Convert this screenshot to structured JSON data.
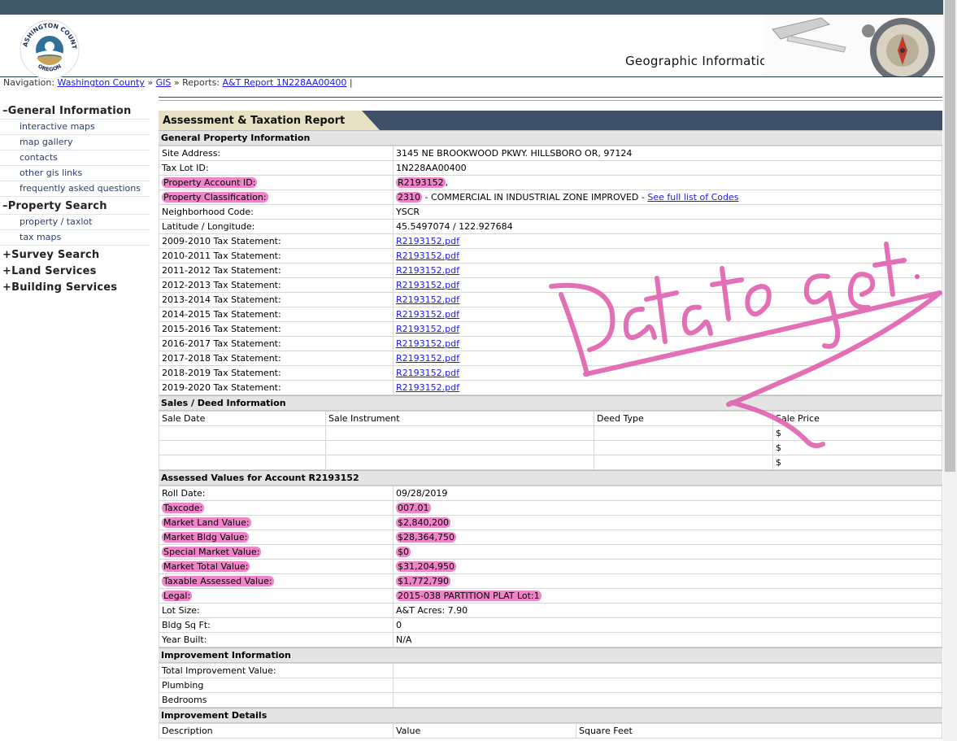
{
  "header": {
    "logo_top_text": "WASHINGTON COUNTY",
    "logo_bottom_text": "OREGON",
    "gis_title": "Geographic Information Systems"
  },
  "nav": {
    "prefix": "Navigation:",
    "crumbs": [
      "Washington County",
      "GIS"
    ],
    "reports_label": "Reports:",
    "report_link": "A&T Report 1N228AA00400",
    "sep": "»",
    "bar": "|"
  },
  "sidebar": {
    "general": {
      "title": "General Information",
      "marker": "–",
      "items": [
        "interactive maps",
        "map gallery",
        "contacts",
        "other gis links",
        "frequently asked questions"
      ]
    },
    "property": {
      "title": "Property Search",
      "marker": "–",
      "items": [
        "property / taxlot",
        "tax maps"
      ]
    },
    "collapsed": [
      {
        "marker": "+",
        "title": "Survey Search"
      },
      {
        "marker": "+",
        "title": "Land Services"
      },
      {
        "marker": "+",
        "title": "Building Services"
      }
    ]
  },
  "report": {
    "title": "Assessment & Taxation Report",
    "general_heading": "General Property Information",
    "general_rows": [
      {
        "label": "Site Address:",
        "value": "3145 NE BROOKWOOD PKWY. HILLSBORO OR, 97124"
      },
      {
        "label": "Tax Lot ID:",
        "value": "1N228AA00400"
      },
      {
        "label": "Property Account ID:",
        "value": "R2193152",
        "suffix": ","
      },
      {
        "label": "Property Classification:",
        "value": "2310",
        "suffix": " - COMMERCIAL IN INDUSTRIAL ZONE IMPROVED - ",
        "link": "See full list of Codes"
      },
      {
        "label": "Neighborhood Code:",
        "value": "YSCR"
      },
      {
        "label": "Latitude / Longitude:",
        "value": "45.5497074 / 122.927684"
      }
    ],
    "tax_statements": [
      {
        "label": "2009-2010 Tax Statement:",
        "file": "R2193152.pdf"
      },
      {
        "label": "2010-2011 Tax Statement:",
        "file": "R2193152.pdf"
      },
      {
        "label": "2011-2012 Tax Statement:",
        "file": "R2193152.pdf"
      },
      {
        "label": "2012-2013 Tax Statement:",
        "file": "R2193152.pdf"
      },
      {
        "label": "2013-2014 Tax Statement:",
        "file": "R2193152.pdf"
      },
      {
        "label": "2014-2015 Tax Statement:",
        "file": "R2193152.pdf"
      },
      {
        "label": "2015-2016 Tax Statement:",
        "file": "R2193152.pdf"
      },
      {
        "label": "2016-2017 Tax Statement:",
        "file": "R2193152.pdf"
      },
      {
        "label": "2017-2018 Tax Statement:",
        "file": "R2193152.pdf"
      },
      {
        "label": "2018-2019 Tax Statement:",
        "file": "R2193152.pdf"
      },
      {
        "label": "2019-2020 Tax Statement:",
        "file": "R2193152.pdf"
      }
    ],
    "sales_heading": "Sales / Deed Information",
    "sales_columns": [
      "Sale Date",
      "Sale Instrument",
      "Deed Type",
      "Sale Price"
    ],
    "sales_rows": [
      [
        "",
        "",
        "",
        "$"
      ],
      [
        "",
        "",
        "",
        "$"
      ],
      [
        "",
        "",
        "",
        "$"
      ]
    ],
    "assessed_heading": "Assessed Values for Account R2193152",
    "assessed_rows": [
      {
        "label": "Roll Date:",
        "value": "09/28/2019",
        "hl": false
      },
      {
        "label": "Taxcode:",
        "value": "007.01",
        "hl": true
      },
      {
        "label": "Market Land Value:",
        "value": "$2,840,200",
        "hl": true
      },
      {
        "label": "Market Bldg Value:",
        "value": "$28,364,750",
        "hl": true
      },
      {
        "label": "Special Market Value:",
        "value": "$0",
        "hl": true
      },
      {
        "label": "Market Total Value:",
        "value": "$31,204,950",
        "hl": true
      },
      {
        "label": "Taxable Assessed Value:",
        "value": "$1,772,790",
        "hl": true
      },
      {
        "label": "Legal:",
        "value": "2015-038 PARTITION PLAT Lot:1",
        "hl": true
      },
      {
        "label": "Lot Size:",
        "value": "A&T Acres: 7.90",
        "hl": false
      },
      {
        "label": "Bldg Sq Ft:",
        "value": "0",
        "hl": false
      },
      {
        "label": "Year Built:",
        "value": "N/A",
        "hl": false
      }
    ],
    "improvement_heading": "Improvement Information",
    "improvement_rows": [
      {
        "label": "Total Improvement Value:",
        "value": ""
      },
      {
        "label": "Plumbing",
        "value": ""
      },
      {
        "label": "Bedrooms",
        "value": ""
      }
    ],
    "details_heading": "Improvement Details",
    "details_columns": [
      "Description",
      "Value",
      "Square Feet"
    ]
  },
  "annotation": {
    "text": "Data to get.",
    "color": "#e060b0"
  },
  "colors": {
    "topbar": "#3f5968",
    "report_bar": "#3f5069",
    "report_tab": "#e8e1c3",
    "highlight": "#ef85c8",
    "link": "#1a1aee"
  }
}
